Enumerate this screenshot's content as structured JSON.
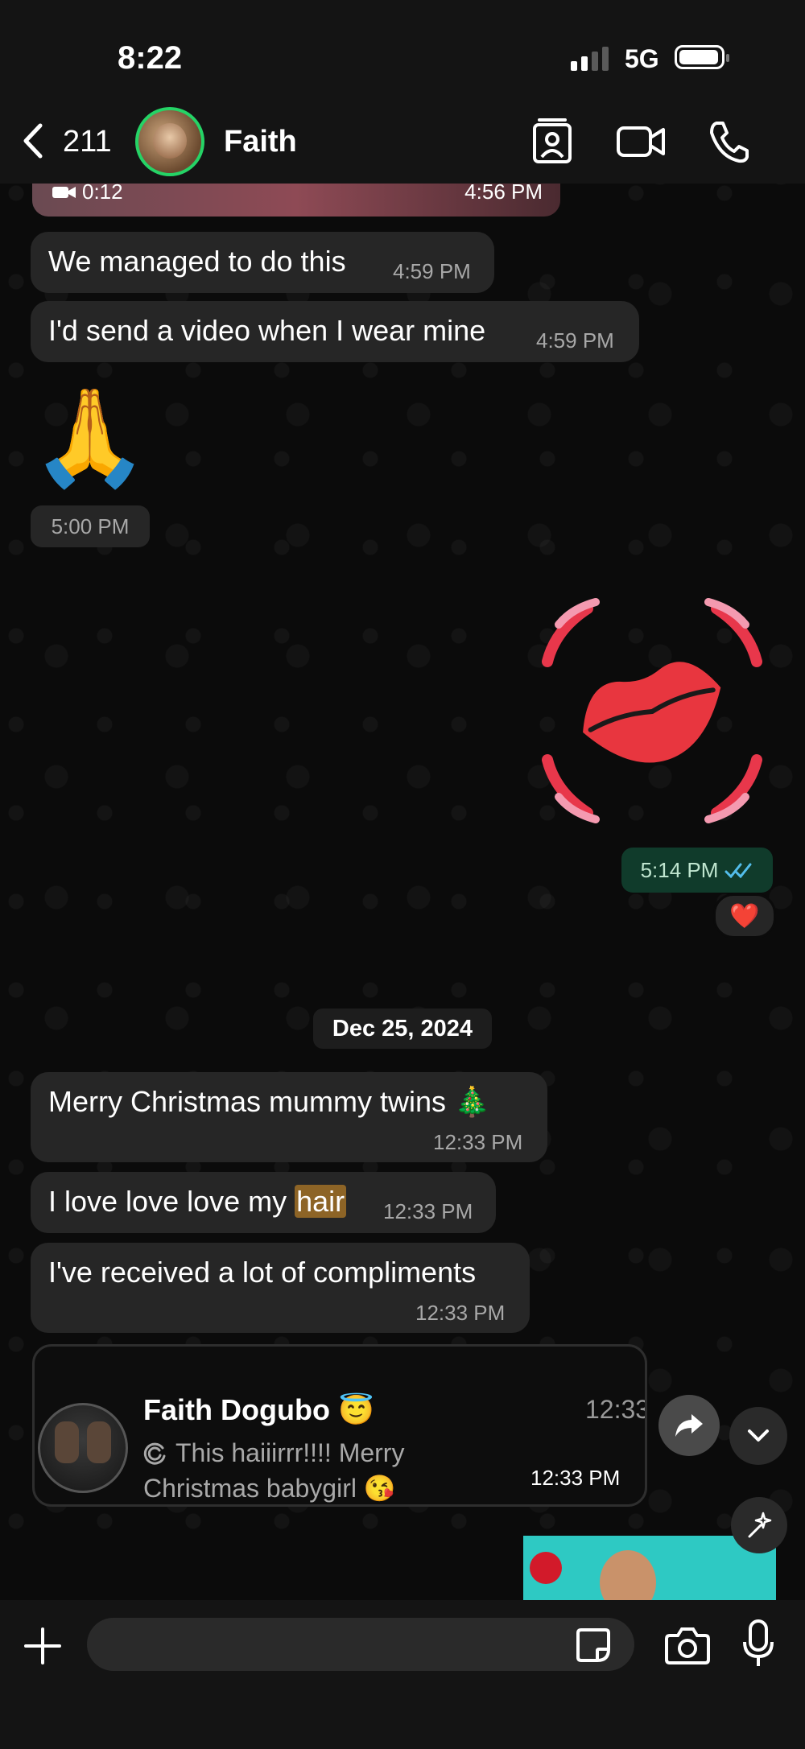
{
  "status_bar": {
    "time": "8:22",
    "network": "5G"
  },
  "header": {
    "back_count": "211",
    "contact_name": "Faith"
  },
  "video_msg": {
    "duration": "0:12",
    "time": "4:56 PM"
  },
  "messages": [
    {
      "text": "We managed to do this",
      "time": "4:59 PM"
    },
    {
      "text": "I'd send a video when I wear mine",
      "time": "4:59 PM"
    }
  ],
  "emoji_msg": {
    "emoji": "🙏",
    "time": "5:00 PM"
  },
  "sticker_msg": {
    "time": "5:14 PM",
    "reaction": "❤️"
  },
  "date_divider": "Dec 25, 2024",
  "dec_messages": [
    {
      "text": "Merry Christmas mummy twins 🎄",
      "time": "12:33 PM"
    },
    {
      "text_before": "I love love love my ",
      "highlight": "hair",
      "time": "12:33 PM"
    },
    {
      "text": "I've received a lot of compliments",
      "time": "12:33 PM"
    }
  ],
  "reply_preview": {
    "sender": "Faith Dogubo 😇",
    "time_top": "12:33",
    "text": "This haiiirrr!!!!  Merry Christmas babygirl 😘",
    "time": "12:33 PM"
  },
  "composer": {
    "placeholder": ""
  },
  "colors": {
    "accent": "#25d366",
    "sent_bubble": "#103b2b",
    "received_bubble": "#262626",
    "read_tick": "#53bdeb"
  }
}
